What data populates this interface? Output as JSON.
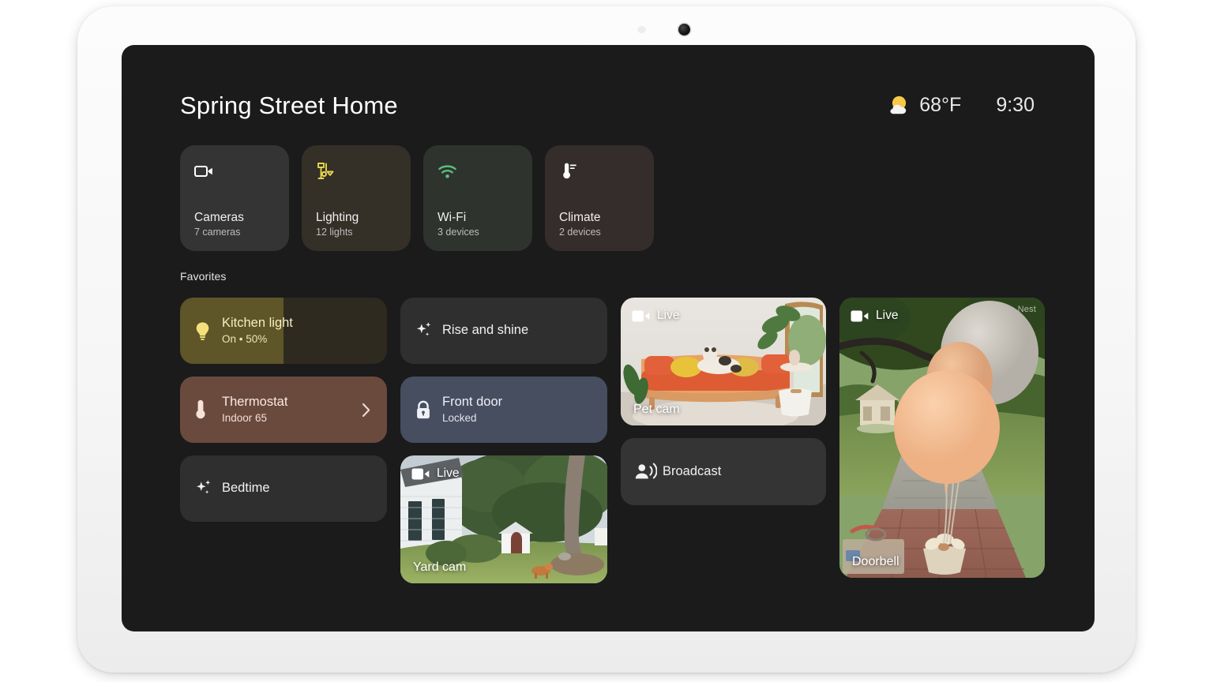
{
  "device": {
    "camera_lens": "front-camera-lens",
    "sensor": "ambient-light-sensor"
  },
  "header": {
    "title": "Spring Street Home",
    "weather_icon": "sun-behind-cloud-icon",
    "temperature": "68°F",
    "time": "9:30"
  },
  "quick_access": [
    {
      "icon": "video-camera-icon",
      "icon_color": "#ffffff",
      "bg": "#343434",
      "title": "Cameras",
      "subtitle": "7 cameras"
    },
    {
      "icon": "lamp-icon",
      "icon_color": "#e5d54f",
      "bg": "#343027",
      "title": "Lighting",
      "subtitle": "12 lights"
    },
    {
      "icon": "wifi-icon",
      "icon_color": "#5bbd7e",
      "bg": "#2e332e",
      "title": "Wi-Fi",
      "subtitle": "3 devices"
    },
    {
      "icon": "thermometer-icon",
      "icon_color": "#ffffff",
      "bg": "#342d2b",
      "title": "Climate",
      "subtitle": "2 devices"
    }
  ],
  "favorites": {
    "section_label": "Favorites",
    "kitchen_light": {
      "icon": "lightbulb-icon",
      "title": "Kitchen light",
      "subtitle": "On • 50%",
      "brightness_percent": 50,
      "fill_color": "#5e5528",
      "track_color": "#2e2a1f"
    },
    "thermostat": {
      "icon": "thermometer-icon",
      "title": "Thermostat",
      "subtitle": "Indoor 65",
      "chevron": "chevron-right-icon",
      "bg": "#6b4a3e"
    },
    "bedtime": {
      "icon": "sparkle-icon",
      "title": "Bedtime",
      "bg": "#2f2f2f"
    },
    "rise_and_shine": {
      "icon": "sparkle-icon",
      "title": "Rise and shine",
      "bg": "#2f2f2f"
    },
    "front_door": {
      "icon": "lock-closed-icon",
      "title": "Front door",
      "subtitle": "Locked",
      "bg": "#474e60"
    },
    "broadcast": {
      "icon": "broadcast-person-icon",
      "title": "Broadcast",
      "bg": "#343434"
    }
  },
  "cameras": [
    {
      "id": "pet-cam",
      "live_label": "Live",
      "name": "Pet cam",
      "badge_icon": "video-camera-filled-icon",
      "watermark": ""
    },
    {
      "id": "yard-cam",
      "live_label": "Live",
      "name": "Yard cam",
      "badge_icon": "video-camera-filled-icon",
      "watermark": ""
    },
    {
      "id": "doorbell",
      "live_label": "Live",
      "name": "Doorbell",
      "badge_icon": "video-camera-filled-icon",
      "watermark": "Nest"
    }
  ]
}
